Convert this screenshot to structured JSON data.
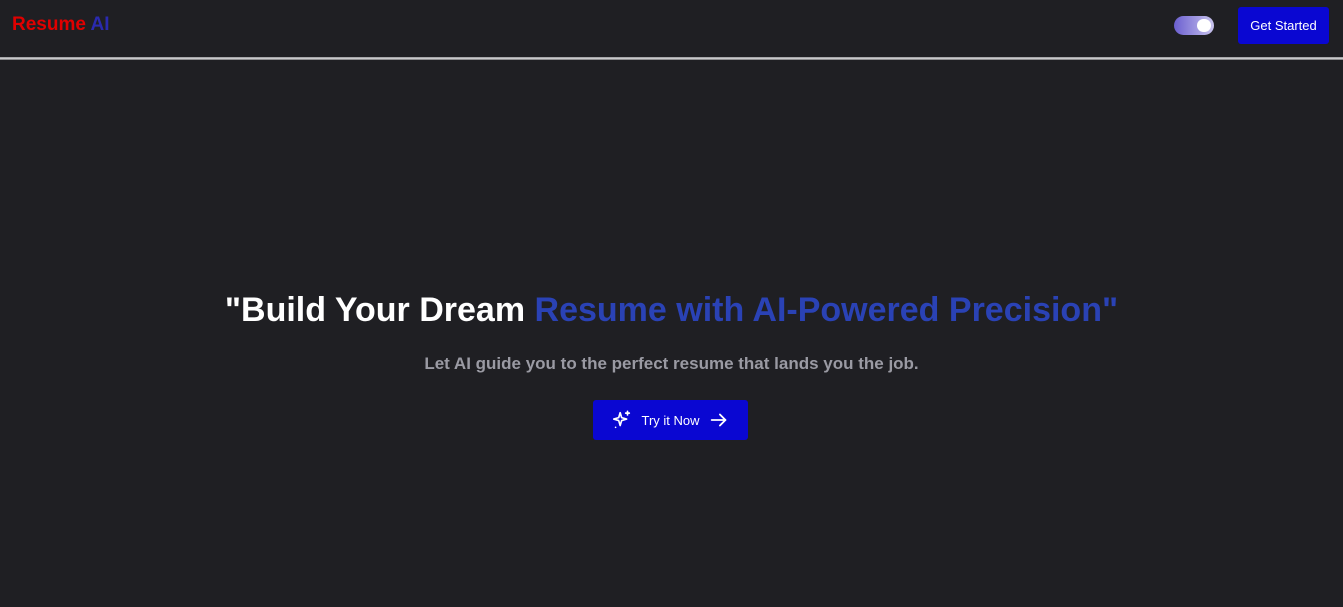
{
  "navbar": {
    "logo": {
      "part1": "Resume",
      "part2": "AI"
    },
    "theme_toggle": {
      "state": "on"
    },
    "get_started_label": "Get Started"
  },
  "hero": {
    "title_part1": "\"Build Your Dream",
    "title_part2": "Resume with AI-Powered Precision\"",
    "subtitle": "Let AI guide you to the perfect resume that lands you the job.",
    "cta": {
      "label": "Try it Now",
      "leading_icon": "sparkles-icon",
      "trailing_icon": "arrow-right-icon"
    }
  },
  "colors": {
    "background": "#1f1f23",
    "logo_red": "#e00000",
    "logo_blue": "#2a2ab0",
    "title_blue": "#2a42b5",
    "button_blue": "#0a07d2",
    "subtitle_gray": "#9a9aa3"
  }
}
